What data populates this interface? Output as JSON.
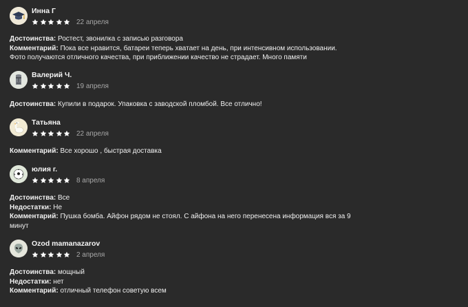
{
  "reviews": [
    {
      "author": "Инна Г",
      "rating": 5,
      "date": "22 апреля",
      "avatar_icon": "graduation-cap-icon",
      "lines": [
        {
          "label": "Достоинства:",
          "text": " Ростест, звонилка с записью разговора"
        },
        {
          "label": "Комментарий:",
          "text": " Пока все нравится, батареи теперь хватает на день, при интенсивном использовании. Фото получаются отличного качества, при приближении качество не страдает. Много памяти"
        }
      ]
    },
    {
      "author": "Валерий Ч.",
      "rating": 5,
      "date": "19 апреля",
      "avatar_icon": "moai-statue-icon",
      "lines": [
        {
          "label": "Достоинства:",
          "text": " Купили в подарок. Упаковка с заводской пломбой. Все отлично!"
        }
      ]
    },
    {
      "author": "Татьяна",
      "rating": 5,
      "date": "22 апреля",
      "avatar_icon": "goose-icon",
      "lines": [
        {
          "label": "Комментарий:",
          "text": " Все хорошо , быстрая доставка"
        }
      ]
    },
    {
      "author": "юлия г.",
      "rating": 5,
      "date": "8 апреля",
      "avatar_icon": "soccer-ball-icon",
      "lines": [
        {
          "label": "Достоинства:",
          "text": " Все"
        },
        {
          "label": "Недостатки:",
          "text": " Не"
        },
        {
          "label": "Комментарий:",
          "text": " Пушка бомба. Айфон рядом не стоял. С айфона на него перенесена информация вся за 9 минут"
        }
      ]
    },
    {
      "author": "Ozod mamanazarov",
      "rating": 5,
      "date": "2 апреля",
      "avatar_icon": "alien-icon",
      "lines": [
        {
          "label": "Достоинства:",
          "text": " мощный"
        },
        {
          "label": "Недостатки:",
          "text": " нет"
        },
        {
          "label": "Комментарий:",
          "text": " отличный телефон советую всем"
        }
      ]
    }
  ],
  "colors": {
    "background": "#2a2a2a",
    "text": "#f0f0f0",
    "date": "#a8a8a8",
    "star": "#ffffff",
    "avatar_bg": "#e6e3db"
  }
}
